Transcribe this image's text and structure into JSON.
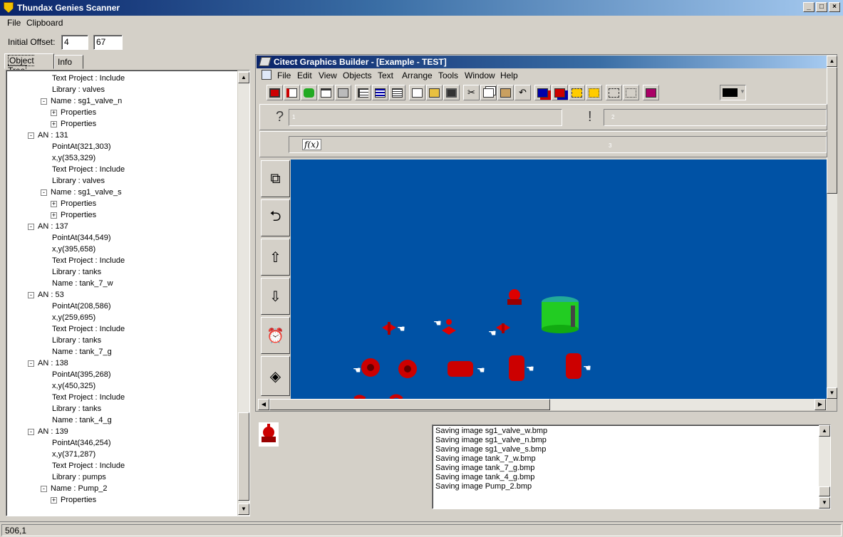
{
  "app": {
    "title": "Thundax Genies Scanner"
  },
  "menu": [
    "File",
    "Clipboard"
  ],
  "offset": {
    "label": "Initial Offset:",
    "x": "4",
    "y": "67"
  },
  "tabs": [
    "Object Tree",
    "Info"
  ],
  "tree": [
    {
      "indent": 2,
      "exp": "",
      "text": "Text Project : Include"
    },
    {
      "indent": 2,
      "exp": "",
      "text": "Library : valves"
    },
    {
      "indent": 1,
      "exp": "-",
      "text": "Name : sg1_valve_n"
    },
    {
      "indent": 2,
      "exp": "+",
      "text": "Properties"
    },
    {
      "indent": 2,
      "exp": "+",
      "text": "Properties"
    },
    {
      "indent": 0,
      "exp": "-",
      "text": "AN : 131"
    },
    {
      "indent": 2,
      "exp": "",
      "text": "PointAt(321,303)"
    },
    {
      "indent": 2,
      "exp": "",
      "text": "x,y(353,329)"
    },
    {
      "indent": 2,
      "exp": "",
      "text": "Text Project : Include"
    },
    {
      "indent": 2,
      "exp": "",
      "text": "Library : valves"
    },
    {
      "indent": 1,
      "exp": "-",
      "text": "Name : sg1_valve_s"
    },
    {
      "indent": 2,
      "exp": "+",
      "text": "Properties"
    },
    {
      "indent": 2,
      "exp": "+",
      "text": "Properties"
    },
    {
      "indent": 0,
      "exp": "-",
      "text": "AN : 137"
    },
    {
      "indent": 2,
      "exp": "",
      "text": "PointAt(344,549)"
    },
    {
      "indent": 2,
      "exp": "",
      "text": "x,y(395,658)"
    },
    {
      "indent": 2,
      "exp": "",
      "text": "Text Project : Include"
    },
    {
      "indent": 2,
      "exp": "",
      "text": "Library : tanks"
    },
    {
      "indent": 2,
      "exp": "",
      "text": "Name : tank_7_w"
    },
    {
      "indent": 0,
      "exp": "-",
      "text": "AN : 53"
    },
    {
      "indent": 2,
      "exp": "",
      "text": "PointAt(208,586)"
    },
    {
      "indent": 2,
      "exp": "",
      "text": "x,y(259,695)"
    },
    {
      "indent": 2,
      "exp": "",
      "text": "Text Project : Include"
    },
    {
      "indent": 2,
      "exp": "",
      "text": "Library : tanks"
    },
    {
      "indent": 2,
      "exp": "",
      "text": "Name : tank_7_g"
    },
    {
      "indent": 0,
      "exp": "-",
      "text": "AN : 138"
    },
    {
      "indent": 2,
      "exp": "",
      "text": "PointAt(395,268)"
    },
    {
      "indent": 2,
      "exp": "",
      "text": "x,y(450,325)"
    },
    {
      "indent": 2,
      "exp": "",
      "text": "Text Project : Include"
    },
    {
      "indent": 2,
      "exp": "",
      "text": "Library : tanks"
    },
    {
      "indent": 2,
      "exp": "",
      "text": "Name : tank_4_g"
    },
    {
      "indent": 0,
      "exp": "-",
      "text": "AN : 139"
    },
    {
      "indent": 2,
      "exp": "",
      "text": "PointAt(346,254)"
    },
    {
      "indent": 2,
      "exp": "",
      "text": "x,y(371,287)"
    },
    {
      "indent": 2,
      "exp": "",
      "text": "Text Project : Include"
    },
    {
      "indent": 2,
      "exp": "",
      "text": "Library : pumps"
    },
    {
      "indent": 1,
      "exp": "-",
      "text": "Name : Pump_2"
    },
    {
      "indent": 2,
      "exp": "+",
      "text": "Properties"
    }
  ],
  "citect": {
    "title": "Citect Graphics Builder - [Example - TEST]",
    "menu": [
      "File",
      "Edit",
      "View",
      "Objects",
      "Text",
      "Arrange",
      "Tools",
      "Window",
      "Help"
    ],
    "prompt_q": "?",
    "prompt_ex": "!",
    "fx": "f(x)",
    "marker1": "1",
    "marker2": "2",
    "marker3": "3"
  },
  "log": [
    "Saving image sg1_valve_w.bmp",
    "Saving image sg1_valve_n.bmp",
    "Saving image sg1_valve_s.bmp",
    "Saving image tank_7_w.bmp",
    "Saving image tank_7_g.bmp",
    "Saving image tank_4_g.bmp",
    "Saving image Pump_2.bmp"
  ],
  "status": "506,1"
}
